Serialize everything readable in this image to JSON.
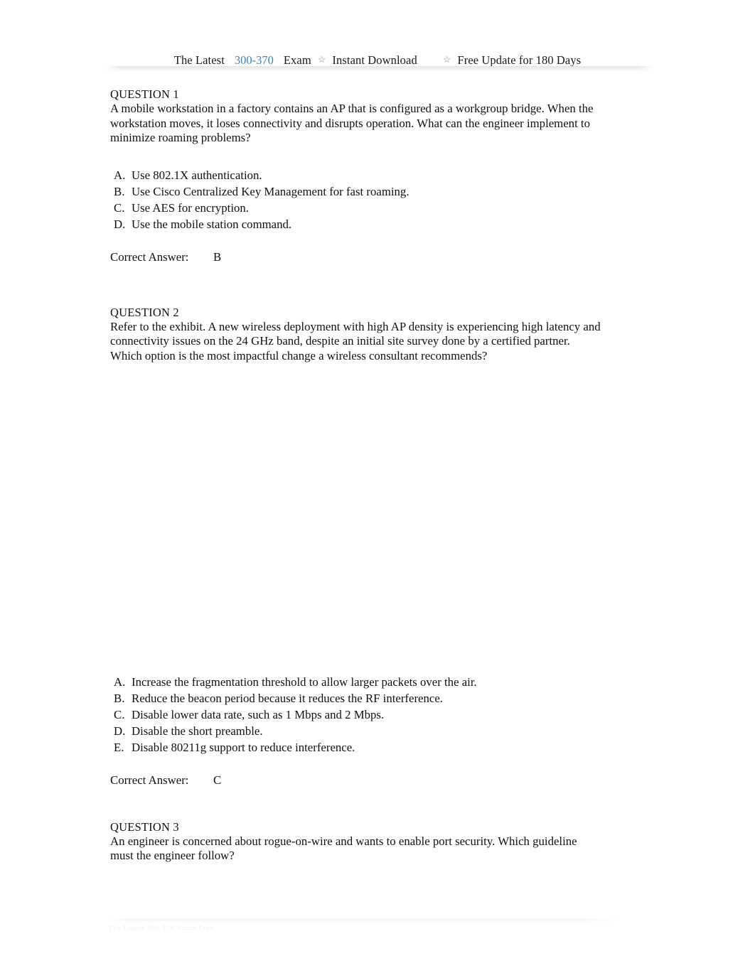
{
  "header": {
    "latest_label": "The Latest",
    "exam_code": "300-370",
    "exam_label": "Exam",
    "star_icon": "☆",
    "instant_download_label": "Instant Download",
    "free_update_label": "Free Update for 180 Days",
    "link_color": "#3b82c4"
  },
  "questions": [
    {
      "title": "QUESTION 1",
      "body": "A mobile workstation in a factory contains an AP that is configured as a workgroup bridge. When the workstation moves, it loses connectivity and disrupts operation. What can the engineer implement to minimize roaming problems?",
      "options": [
        {
          "letter": "A.",
          "text": "Use 802.1X authentication."
        },
        {
          "letter": "B.",
          "text": "Use Cisco Centralized Key Management for fast roaming."
        },
        {
          "letter": "C.",
          "text": "Use AES for encryption."
        },
        {
          "letter": "D.",
          "text": "Use the mobile station command."
        }
      ],
      "answer_label": "Correct Answer:",
      "answer_value": "B"
    },
    {
      "title": "QUESTION 2",
      "body": "Refer to the exhibit. A new wireless deployment with high AP density is experiencing high latency and connectivity issues on the 24 GHz band, despite an initial site survey done by a certified partner. Which option is the most impactful change a wireless consultant recommends?",
      "options": [
        {
          "letter": "A.",
          "text": "Increase the fragmentation threshold to allow larger packets over the air."
        },
        {
          "letter": "B.",
          "text": "Reduce the beacon period because it reduces the RF interference."
        },
        {
          "letter": "C.",
          "text": "Disable lower data rate, such as 1 Mbps and 2 Mbps."
        },
        {
          "letter": "D.",
          "text": "Disable the short preamble."
        },
        {
          "letter": "E.",
          "text": "Disable 80211g support to reduce interference."
        }
      ],
      "answer_label": "Correct Answer:",
      "answer_value": "C"
    },
    {
      "title": "QUESTION 3",
      "body": "An engineer is concerned about rogue-on-wire and wants to enable port security. Which guideline must the engineer follow?"
    }
  ],
  "footer": {
    "watermark": "The  Latest                    300-370                Exam                        Free"
  }
}
